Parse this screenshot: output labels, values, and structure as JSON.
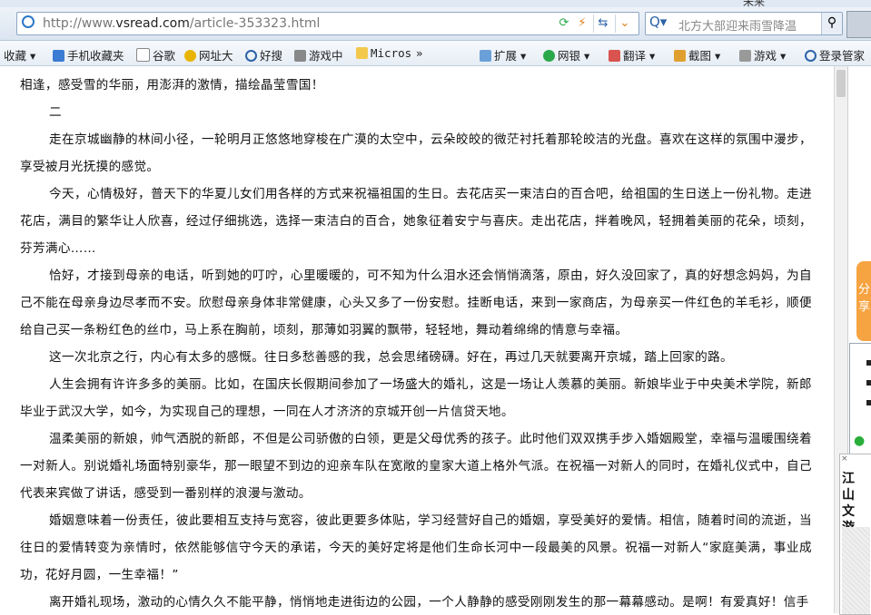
{
  "browser": {
    "top_text": "未来",
    "url_prefix": "http://www.",
    "url_domain": "vsread.com",
    "url_path": "/article-353323.html",
    "search_text": "北方大部迎来雨雪降温",
    "icons": [
      "ie-icon",
      "refresh-icon",
      "lightning-icon",
      "back-forward-icon",
      "dropdown-icon",
      "search-icon",
      "avatar-icon"
    ]
  },
  "favorites": [
    {
      "label": "收藏"
    },
    {
      "label": "手机收藏夹"
    },
    {
      "label": "谷歌"
    },
    {
      "label": "网址大"
    },
    {
      "label": "好搜"
    },
    {
      "label": "游戏中"
    },
    {
      "label": "Micros"
    },
    {
      "label": "»"
    },
    {
      "label": "扩展"
    },
    {
      "label": "网银"
    },
    {
      "label": "翻译"
    },
    {
      "label": "截图"
    },
    {
      "label": "游戏"
    },
    {
      "label": "登录管家"
    }
  ],
  "article": {
    "p0": "相逢，感受雪的华丽，用澎湃的激情，描绘晶莹雪国！",
    "p1": "二",
    "p2": "走在京城幽静的林间小径，一轮明月正悠悠地穿梭在广漠的太空中，云朵皎皎的微茫衬托着那轮皎洁的光盘。喜欢在这样的氛围中漫步，享受被月光抚摸的感觉。",
    "p3": "今天，心情极好，普天下的华夏儿女们用各样的方式来祝福祖国的生日。去花店买一束洁白的百合吧，给祖国的生日送上一份礼物。走进花店，满目的繁华让人欣喜，经过仔细挑选，选择一束洁白的百合，她象征着安宁与喜庆。走出花店，拌着晚风，轻拥着美丽的花朵，顷刻，芬芳满心……",
    "p4": "恰好，才接到母亲的电话，听到她的叮咛，心里暖暖的，可不知为什么泪水还会悄悄滴落，原由，好久没回家了，真的好想念妈妈，为自己不能在母亲身边尽孝而不安。欣慰母亲身体非常健康，心头又多了一份安慰。挂断电话，来到一家商店，为母亲买一件红色的羊毛衫，顺便给自己买一条粉红色的丝巾，马上系在胸前，顷刻，那薄如羽翼的飘带，轻轻地，舞动着绵绵的情意与幸福。",
    "p5": "这一次北京之行，内心有太多的感慨。往日多愁善感的我，总会思绪磅礴。好在，再过几天就要离开京城，踏上回家的路。",
    "p6": "人生会拥有许许多多的美丽。比如，在国庆长假期间参加了一场盛大的婚礼，这是一场让人羡慕的美丽。新娘毕业于中央美术学院，新郎毕业于武汉大学，如今，为实现自己的理想，一同在人才济济的京城开创一片信贷天地。",
    "p7": "温柔美丽的新娘，帅气洒脱的新郎，不但是公司骄傲的白领，更是父母优秀的孩子。此时他们双双携手步入婚姻殿堂，幸福与温暖围绕着一对新人。别说婚礼场面特别豪华，那一眼望不到边的迎亲车队在宽敞的皇家大道上格外气派。在祝福一对新人的同时，在婚礼仪式中，自己代表来宾做了讲话，感受到一番别样的浪漫与激动。",
    "p8": "婚姻意味着一份责任，彼此要相互支持与宽容，彼此更要多体贴，学习经营好自己的婚姻，享受美好的爱情。相信，随着时间的流逝，当往日的爱情转变为亲情时，依然能够信守今天的承诺，今天的美好定将是他们生命长河中一段最美的风景。祝福一对新人“家庭美满，事业成功，花好月圆，一生幸福！”",
    "p9": "离开婚礼现场，激动的心情久久不能平静，悄悄地走进街边的公园，一个人静静的感受刚刚发生的那一幕幕感动。是啊！有爱真好！信手"
  },
  "sidebar": {
    "share_text": "分享",
    "ad_text": "江山文游"
  }
}
